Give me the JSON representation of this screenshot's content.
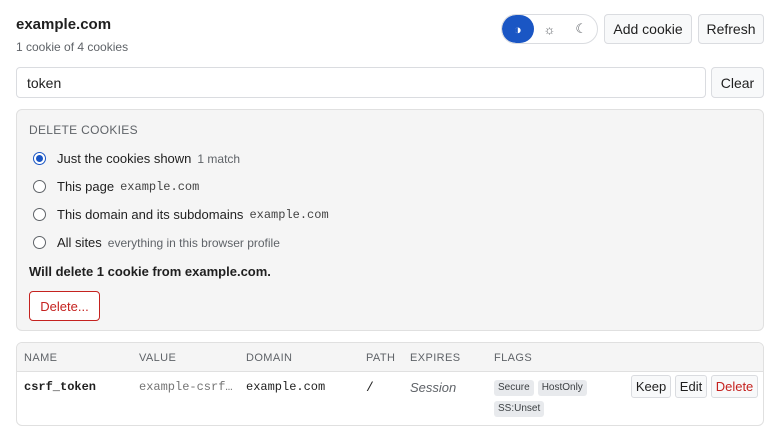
{
  "header": {
    "site": "example.com",
    "subtitle": "1 cookie of 4 cookies"
  },
  "theme_toggle": {
    "options": [
      {
        "icon": "contrast-icon",
        "glyph": "◑",
        "active": true
      },
      {
        "icon": "sun-icon",
        "glyph": "☼",
        "active": false
      },
      {
        "icon": "moon-icon",
        "glyph": "☾",
        "active": false
      }
    ]
  },
  "toolbar": {
    "add_label": "Add cookie",
    "refresh_label": "Refresh"
  },
  "filter": {
    "value": "token",
    "clear_label": "Clear"
  },
  "delete_panel": {
    "title": "DELETE COOKIES",
    "options": [
      {
        "label": "Just the cookies shown",
        "hint": "1 match",
        "mono": "",
        "checked": true
      },
      {
        "label": "This page",
        "hint": "",
        "mono": "example.com",
        "checked": false
      },
      {
        "label": "This domain and its subdomains",
        "hint": "",
        "mono": "example.com",
        "checked": false
      },
      {
        "label": "All sites",
        "hint": "everything in this browser profile",
        "mono": "",
        "checked": false
      }
    ],
    "summary": "Will delete 1 cookie from example.com.",
    "delete_label": "Delete..."
  },
  "table": {
    "columns": [
      "NAME",
      "VALUE",
      "DOMAIN",
      "PATH",
      "EXPIRES",
      "FLAGS"
    ],
    "rows": [
      {
        "name": "csrf_token",
        "value": "example-csrf…",
        "domain": "example.com",
        "path": "/",
        "expires": "Session",
        "flags": [
          "Secure",
          "HostOnly",
          "SS:Unset"
        ],
        "actions": {
          "keep": "Keep",
          "edit": "Edit",
          "delete": "Delete"
        }
      }
    ]
  },
  "colors": {
    "accent": "#1a56c4",
    "danger": "#c5221f"
  }
}
